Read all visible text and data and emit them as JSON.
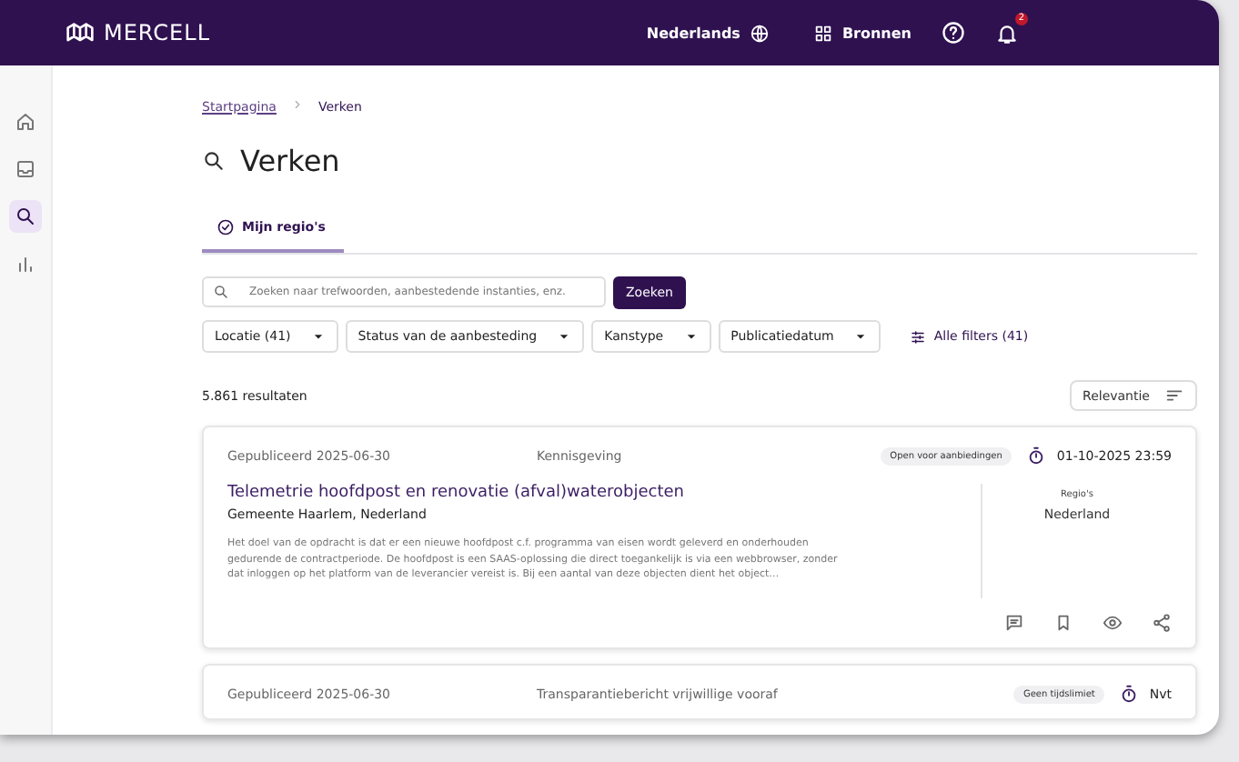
{
  "header": {
    "logo": "MERCELL",
    "language": "Nederlands",
    "resources": "Bronnen",
    "notification_count": "2"
  },
  "sidebar": {
    "items": [
      {
        "selected": false
      },
      {
        "selected": false
      },
      {
        "selected": true
      },
      {
        "selected": false
      }
    ]
  },
  "breadcrumb": [
    "Startpagina",
    "Verken"
  ],
  "page_title": "Verken",
  "tabs": [
    {
      "label": "Mijn regio's",
      "selected": true
    }
  ],
  "search": {
    "placeholder": "Zoeken naar trefwoorden, aanbestedende instanties, enz.",
    "button": "Zoeken"
  },
  "filters": [
    "Locatie (41)",
    "Status van de aanbesteding",
    "Kanstype",
    "Publicatiedatum"
  ],
  "all_filters": "Alle filters (41)",
  "result_count": "5.861 resultaten",
  "sort": "Relevantie",
  "results": [
    {
      "published": "Gepubliceerd 2025-06-30",
      "type": "Kennisgeving",
      "status": "Open voor aanbiedingen",
      "deadline": "01-10-2025 23:59",
      "title": "Telemetrie hoofdpost en renovatie (afval)waterobjecten",
      "buyer": "Gemeente Haarlem, Nederland",
      "description": "Het doel van de opdracht is dat er een nieuwe hoofdpost c.f. programma van eisen wordt geleverd en onderhouden gedurende de contractperiode. De hoofdpost is een SAAS-oplossing die direct toegankelijk is via een webbrowser, zonder dat inloggen op het platform van de leverancier vereist is. Bij een aantal van deze objecten dient het object…",
      "regions_label": "Regio's",
      "region": "Nederland"
    },
    {
      "published": "Gepubliceerd 2025-06-30",
      "type": "Transparantiebericht vrijwillige vooraf",
      "status": "Geen tijdslimiet",
      "deadline": "Nvt"
    }
  ]
}
